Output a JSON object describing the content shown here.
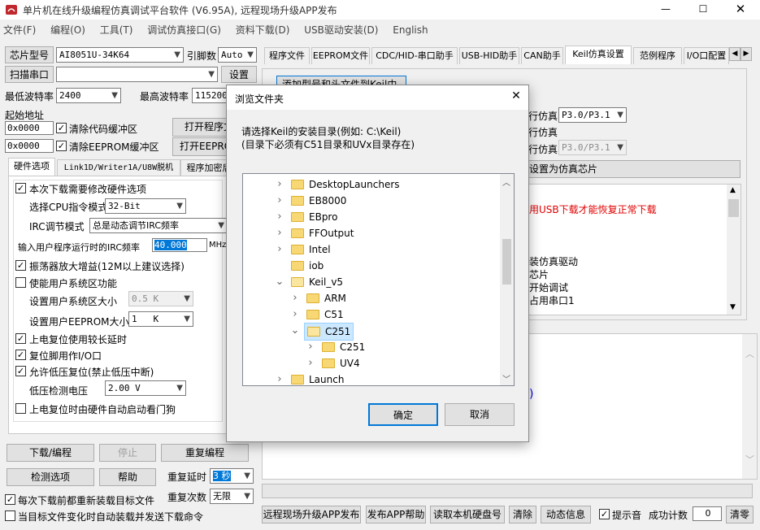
{
  "window": {
    "title": "单片机在线升级编程仿真调试平台软件 (V6.95A), 远程现场升级APP发布"
  },
  "menu": [
    "文件(F)",
    "编程(O)",
    "工具(T)",
    "调试仿真接口(G)",
    "资料下载(D)",
    "USB驱动安装(D)",
    "English"
  ],
  "left": {
    "chip_label": "芯片型号",
    "chip_value": "AI8051U-34K64",
    "pin_label": "引脚数",
    "pin_value": "Auto",
    "scan_label": "扫描串口",
    "setup_label": "设置",
    "min_baud_label": "最低波特率",
    "min_baud_value": "2400",
    "max_baud_label": "最高波特率",
    "max_baud_value": "115200",
    "start_addr_label": "起始地址",
    "addr1": "0x0000",
    "clear_code": "清除代码缓冲区",
    "open_prog": "打开程序文",
    "addr2": "0x0000",
    "clear_eeprom": "清除EEPROM缓冲区",
    "open_eeprom": "打开EEPRO",
    "tabs": [
      "硬件选项",
      "Link1D/Writer1A/U8W脱机",
      "程序加密后"
    ],
    "hw": {
      "opt1": "本次下载需要修改硬件选项",
      "cpu_label": "选择CPU指令模式",
      "cpu_value": "32-Bit",
      "irc_label": "IRC调节模式",
      "irc_value": "总是动态调节IRC频率",
      "freq_label": "输入用户程序运行时的IRC频率",
      "freq_value": "40.000",
      "freq_unit": "MHz",
      "opt_osc": "振荡器放大增益(12M以上建议选择)",
      "opt_sys": "使能用户系统区功能",
      "sys_size_label": "设置用户系统区大小",
      "sys_size_value": "0.5 K",
      "eep_size_label": "设置用户EEPROM大小",
      "eep_size_value": "1   K",
      "opt_delay": "上电复位使用较长延时",
      "opt_rst": "复位脚用作I/O口",
      "opt_lvr": "允许低压复位(禁止低压中断)",
      "lvd_label": "低压检测电压",
      "lvd_value": "2.00 V",
      "opt_wdt": "上电复位时由硬件自动启动看门狗"
    },
    "btn_download": "下载/编程",
    "btn_stop": "停止",
    "btn_reprog": "重复编程",
    "btn_detect": "检测选项",
    "btn_help": "帮助",
    "repeat_delay_label": "重复延时",
    "repeat_delay_value": "3 秒",
    "repeat_count_label": "重复次数",
    "repeat_count_value": "无限",
    "chk_reload": "每次下载前都重新装载目标文件",
    "chk_auto": "当目标文件变化时自动装载并发送下载命令"
  },
  "right": {
    "tabs": [
      "程序文件",
      "EEPROM文件",
      "CDC/HID-串口助手",
      "USB-HID助手",
      "CAN助手",
      "Keil仿真设置",
      "范例程序",
      "I/O口配置"
    ],
    "add_btn": "添加型号和头文件到Keil中",
    "sim1_label": "行仿真",
    "sim1_value": "P3.0/P3.1",
    "sim2_label": "行仿真",
    "sim3_label": "行仿真",
    "sim3_value": "P3.0/P3.1",
    "set_chip_btn": "设置为仿真芯片",
    "info_red": "用USB下载才能恢复正常下载",
    "info_lines": [
      "装仿真驱动",
      "芯片",
      "开始调试",
      "占用串口1"
    ],
    "link_text": ")"
  },
  "bottom": {
    "btn_remote": "远程现场升级APP发布",
    "btn_app_help": "发布APP帮助",
    "btn_read_disk": "读取本机硬盘号",
    "btn_clear": "清除",
    "btn_dyn": "动态信息",
    "chk_sound": "提示音",
    "success_label": "成功计数",
    "success_value": "0",
    "btn_clear2": "清零"
  },
  "dialog": {
    "title": "浏览文件夹",
    "line1": "请选择Keil的安装目录(例如: C:\\Keil)",
    "line2": "(目录下必须有C51目录和UVx目录存在)",
    "tree": [
      {
        "name": "DesktopLaunchers",
        "indent": 0,
        "exp": ">"
      },
      {
        "name": "EB8000",
        "indent": 0,
        "exp": ">"
      },
      {
        "name": "EBpro",
        "indent": 0,
        "exp": ">"
      },
      {
        "name": "FFOutput",
        "indent": 0,
        "exp": ">"
      },
      {
        "name": "Intel",
        "indent": 0,
        "exp": ">"
      },
      {
        "name": "iob",
        "indent": 0,
        "exp": ""
      },
      {
        "name": "Keil_v5",
        "indent": 0,
        "exp": "v"
      },
      {
        "name": "ARM",
        "indent": 1,
        "exp": ">"
      },
      {
        "name": "C51",
        "indent": 1,
        "exp": ">"
      },
      {
        "name": "C251",
        "indent": 1,
        "exp": "v",
        "selected": true
      },
      {
        "name": "C251",
        "indent": 2,
        "exp": ">"
      },
      {
        "name": "UV4",
        "indent": 2,
        "exp": ">"
      },
      {
        "name": "Launch",
        "indent": 0,
        "exp": ">"
      }
    ],
    "ok": "确定",
    "cancel": "取消"
  }
}
